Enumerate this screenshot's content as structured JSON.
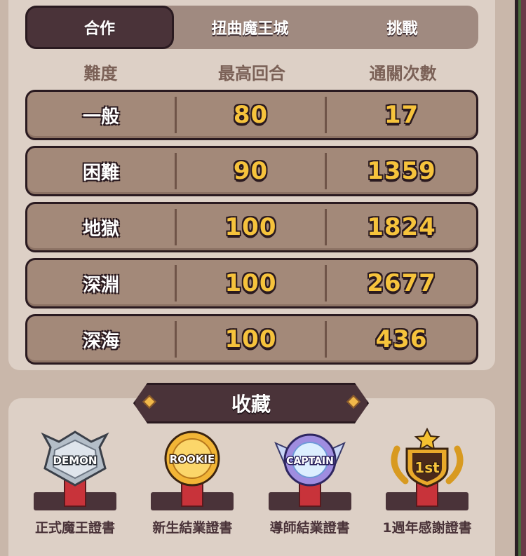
{
  "tabs": [
    {
      "label": "合作",
      "active": true
    },
    {
      "label": "扭曲魔王城",
      "active": false
    },
    {
      "label": "挑戰",
      "active": false
    }
  ],
  "columns": [
    "難度",
    "最高回合",
    "通關次數"
  ],
  "rows": [
    {
      "difficulty": "一般",
      "best_round": "80",
      "clears": "17"
    },
    {
      "difficulty": "困難",
      "best_round": "90",
      "clears": "1359"
    },
    {
      "difficulty": "地獄",
      "best_round": "100",
      "clears": "1824"
    },
    {
      "difficulty": "深淵",
      "best_round": "100",
      "clears": "2677"
    },
    {
      "difficulty": "深海",
      "best_round": "100",
      "clears": "436"
    }
  ],
  "collection": {
    "title": "收藏",
    "medals": [
      {
        "badge": "DEMON",
        "label": "正式魔王證書",
        "icon": "demon-medal-icon",
        "color": "#9aa6b2"
      },
      {
        "badge": "ROOKIE",
        "label": "新生結業證書",
        "icon": "rookie-medal-icon",
        "color": "#f2b536"
      },
      {
        "badge": "CAPTAIN",
        "label": "導師結業證書",
        "icon": "captain-medal-icon",
        "color": "#9f8de0"
      },
      {
        "badge": "1st",
        "label": "1週年感謝證書",
        "icon": "anniversary-medal-icon",
        "color": "#e9a92a"
      }
    ]
  },
  "colors": {
    "accent": "#f6c33c",
    "panel": "#ddd0c6",
    "row": "#a38979",
    "dark": "#4a3339"
  }
}
